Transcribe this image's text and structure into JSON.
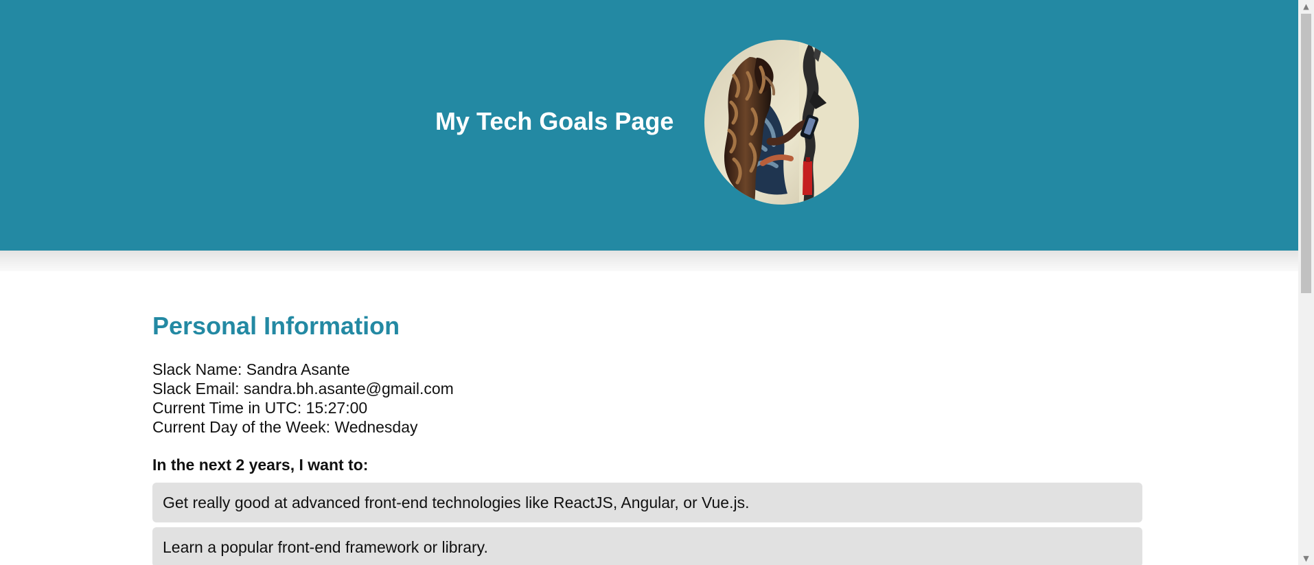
{
  "header": {
    "title": "My Tech Goals Page",
    "avatar_icon": "profile-photo-person-holding-phone-icon"
  },
  "personal_info": {
    "title": "Personal Information",
    "lines": [
      "Slack Name: Sandra Asante",
      "Slack Email: sandra.bh.asante@gmail.com",
      "Current Time in UTC: 15:27:00",
      "Current Day of the Week: Wednesday"
    ]
  },
  "goals": {
    "heading": "In the next 2 years, I want to:",
    "items": [
      "Get really good at advanced front-end technologies like ReactJS, Angular, or Vue.js.",
      "Learn a popular front-end framework or library."
    ]
  },
  "scrollbar": {
    "up_icon": "chevron-up-icon",
    "down_icon": "chevron-down-icon"
  },
  "colors": {
    "header_background": "#2389a3",
    "accent_text": "#2389a3",
    "goal_background": "#e1e1e1",
    "scrollbar_track": "#f1f1f1",
    "scrollbar_thumb": "#c1c1c1"
  }
}
